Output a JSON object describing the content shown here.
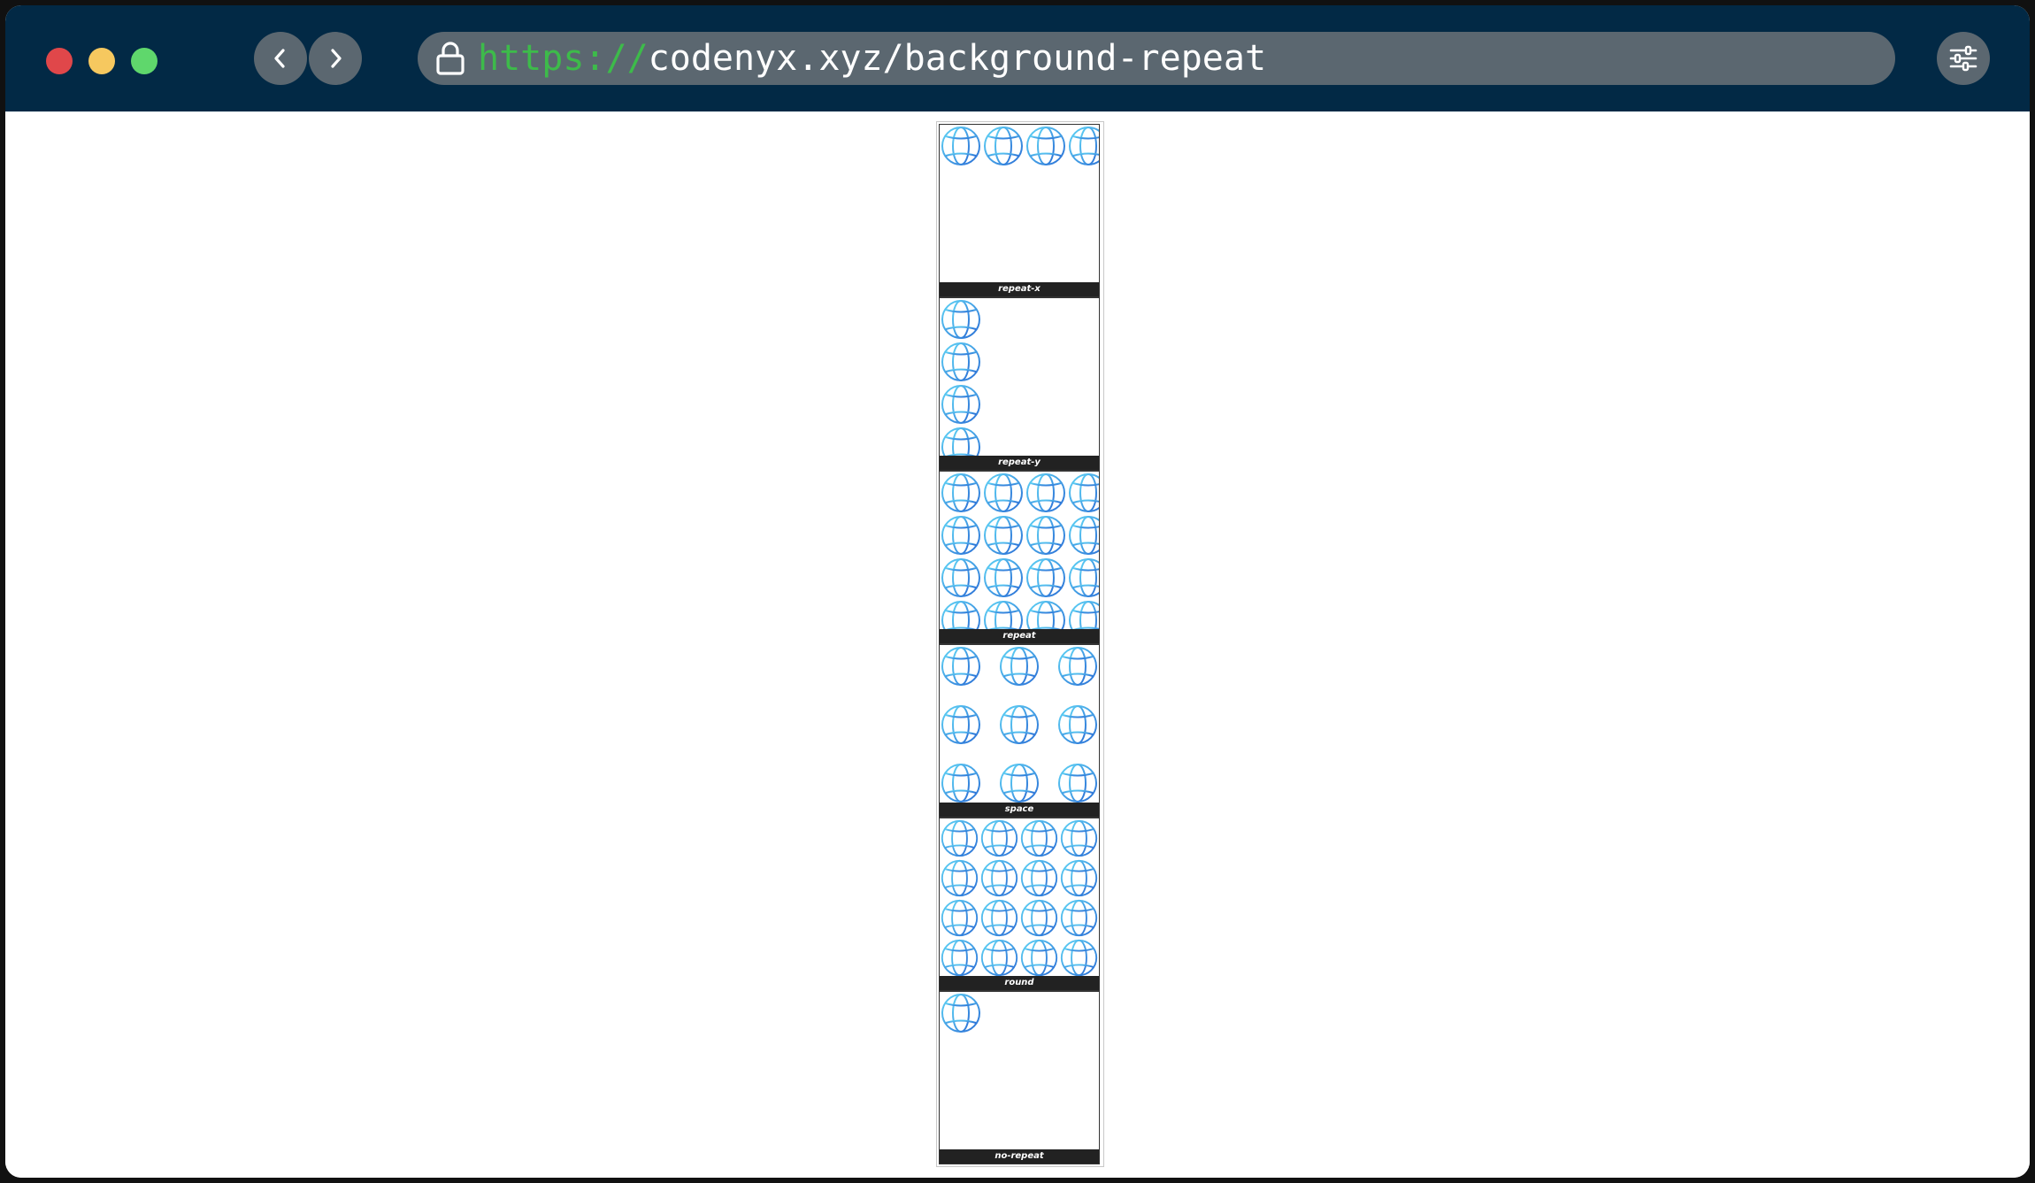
{
  "browser": {
    "url_scheme": "https://",
    "url_rest": "codenyx.xyz/background-repeat",
    "titlebar_color": "#022945",
    "control_color": "#5b6770"
  },
  "demos": [
    {
      "label": "repeat-x",
      "mode": "repeat-x"
    },
    {
      "label": "repeat-y",
      "mode": "repeat-y"
    },
    {
      "label": "repeat",
      "mode": "repeat"
    },
    {
      "label": "space",
      "mode": "space"
    },
    {
      "label": "round",
      "mode": "round"
    },
    {
      "label": "no-repeat",
      "mode": "no-repeat"
    }
  ],
  "icons": {
    "tile": "globe-icon",
    "lock": "lock-icon",
    "settings": "sliders-icon"
  }
}
